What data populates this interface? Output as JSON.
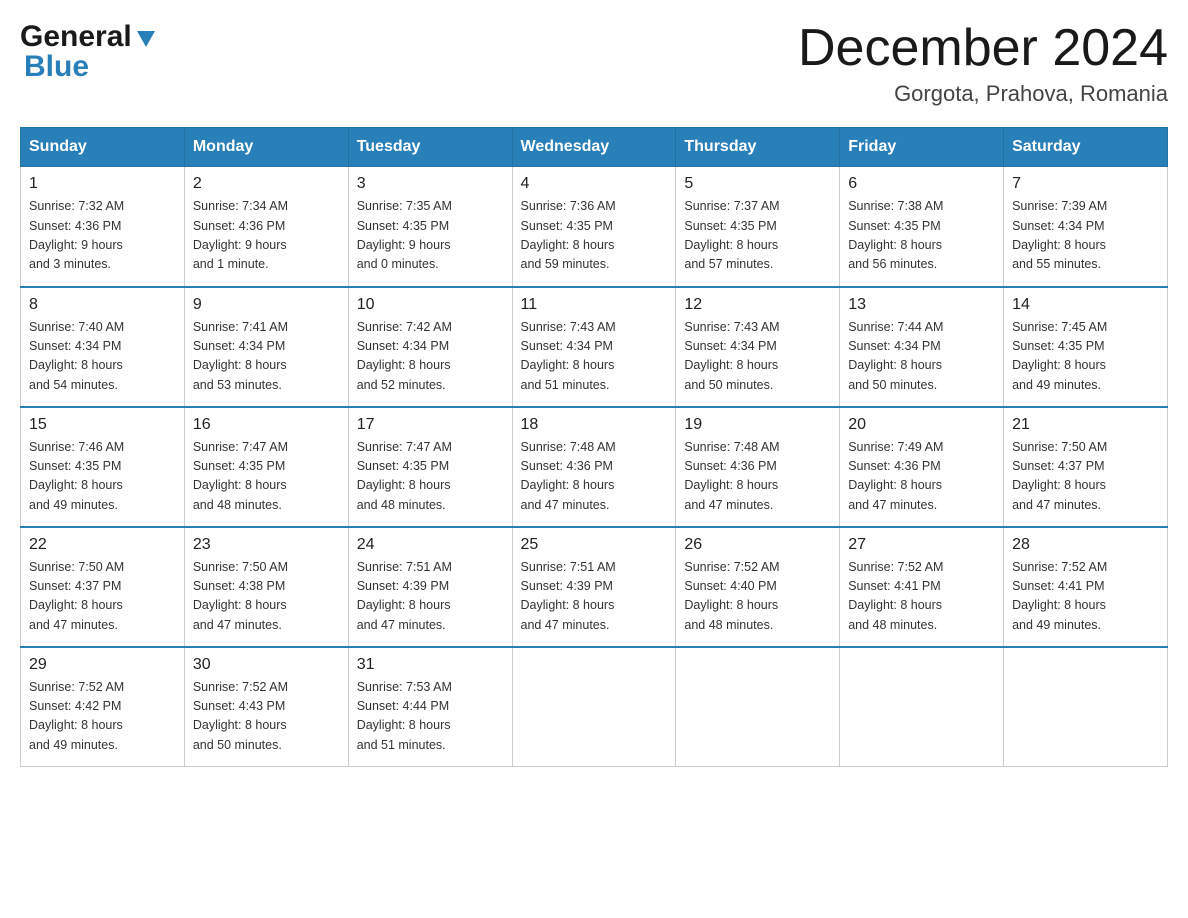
{
  "header": {
    "logo_general": "General",
    "logo_blue": "Blue",
    "month_title": "December 2024",
    "location": "Gorgota, Prahova, Romania"
  },
  "days_of_week": [
    "Sunday",
    "Monday",
    "Tuesday",
    "Wednesday",
    "Thursday",
    "Friday",
    "Saturday"
  ],
  "weeks": [
    [
      {
        "day": "1",
        "sunrise": "7:32 AM",
        "sunset": "4:36 PM",
        "daylight": "9 hours and 3 minutes."
      },
      {
        "day": "2",
        "sunrise": "7:34 AM",
        "sunset": "4:36 PM",
        "daylight": "9 hours and 1 minute."
      },
      {
        "day": "3",
        "sunrise": "7:35 AM",
        "sunset": "4:35 PM",
        "daylight": "9 hours and 0 minutes."
      },
      {
        "day": "4",
        "sunrise": "7:36 AM",
        "sunset": "4:35 PM",
        "daylight": "8 hours and 59 minutes."
      },
      {
        "day": "5",
        "sunrise": "7:37 AM",
        "sunset": "4:35 PM",
        "daylight": "8 hours and 57 minutes."
      },
      {
        "day": "6",
        "sunrise": "7:38 AM",
        "sunset": "4:35 PM",
        "daylight": "8 hours and 56 minutes."
      },
      {
        "day": "7",
        "sunrise": "7:39 AM",
        "sunset": "4:34 PM",
        "daylight": "8 hours and 55 minutes."
      }
    ],
    [
      {
        "day": "8",
        "sunrise": "7:40 AM",
        "sunset": "4:34 PM",
        "daylight": "8 hours and 54 minutes."
      },
      {
        "day": "9",
        "sunrise": "7:41 AM",
        "sunset": "4:34 PM",
        "daylight": "8 hours and 53 minutes."
      },
      {
        "day": "10",
        "sunrise": "7:42 AM",
        "sunset": "4:34 PM",
        "daylight": "8 hours and 52 minutes."
      },
      {
        "day": "11",
        "sunrise": "7:43 AM",
        "sunset": "4:34 PM",
        "daylight": "8 hours and 51 minutes."
      },
      {
        "day": "12",
        "sunrise": "7:43 AM",
        "sunset": "4:34 PM",
        "daylight": "8 hours and 50 minutes."
      },
      {
        "day": "13",
        "sunrise": "7:44 AM",
        "sunset": "4:34 PM",
        "daylight": "8 hours and 50 minutes."
      },
      {
        "day": "14",
        "sunrise": "7:45 AM",
        "sunset": "4:35 PM",
        "daylight": "8 hours and 49 minutes."
      }
    ],
    [
      {
        "day": "15",
        "sunrise": "7:46 AM",
        "sunset": "4:35 PM",
        "daylight": "8 hours and 49 minutes."
      },
      {
        "day": "16",
        "sunrise": "7:47 AM",
        "sunset": "4:35 PM",
        "daylight": "8 hours and 48 minutes."
      },
      {
        "day": "17",
        "sunrise": "7:47 AM",
        "sunset": "4:35 PM",
        "daylight": "8 hours and 48 minutes."
      },
      {
        "day": "18",
        "sunrise": "7:48 AM",
        "sunset": "4:36 PM",
        "daylight": "8 hours and 47 minutes."
      },
      {
        "day": "19",
        "sunrise": "7:48 AM",
        "sunset": "4:36 PM",
        "daylight": "8 hours and 47 minutes."
      },
      {
        "day": "20",
        "sunrise": "7:49 AM",
        "sunset": "4:36 PM",
        "daylight": "8 hours and 47 minutes."
      },
      {
        "day": "21",
        "sunrise": "7:50 AM",
        "sunset": "4:37 PM",
        "daylight": "8 hours and 47 minutes."
      }
    ],
    [
      {
        "day": "22",
        "sunrise": "7:50 AM",
        "sunset": "4:37 PM",
        "daylight": "8 hours and 47 minutes."
      },
      {
        "day": "23",
        "sunrise": "7:50 AM",
        "sunset": "4:38 PM",
        "daylight": "8 hours and 47 minutes."
      },
      {
        "day": "24",
        "sunrise": "7:51 AM",
        "sunset": "4:39 PM",
        "daylight": "8 hours and 47 minutes."
      },
      {
        "day": "25",
        "sunrise": "7:51 AM",
        "sunset": "4:39 PM",
        "daylight": "8 hours and 47 minutes."
      },
      {
        "day": "26",
        "sunrise": "7:52 AM",
        "sunset": "4:40 PM",
        "daylight": "8 hours and 48 minutes."
      },
      {
        "day": "27",
        "sunrise": "7:52 AM",
        "sunset": "4:41 PM",
        "daylight": "8 hours and 48 minutes."
      },
      {
        "day": "28",
        "sunrise": "7:52 AM",
        "sunset": "4:41 PM",
        "daylight": "8 hours and 49 minutes."
      }
    ],
    [
      {
        "day": "29",
        "sunrise": "7:52 AM",
        "sunset": "4:42 PM",
        "daylight": "8 hours and 49 minutes."
      },
      {
        "day": "30",
        "sunrise": "7:52 AM",
        "sunset": "4:43 PM",
        "daylight": "8 hours and 50 minutes."
      },
      {
        "day": "31",
        "sunrise": "7:53 AM",
        "sunset": "4:44 PM",
        "daylight": "8 hours and 51 minutes."
      },
      null,
      null,
      null,
      null
    ]
  ]
}
